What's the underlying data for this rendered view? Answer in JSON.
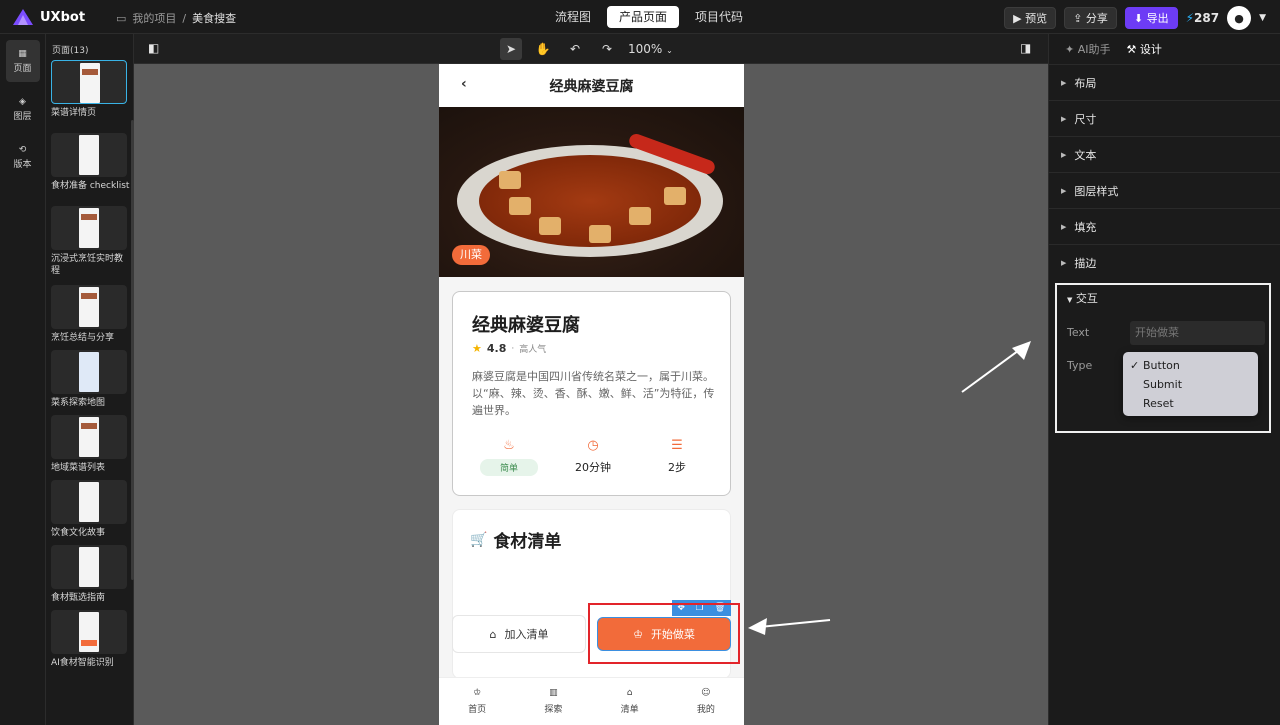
{
  "app": {
    "name": "UXbot",
    "credits": "287"
  },
  "breadcrumb": {
    "project_root": "我的项目",
    "separator": "/",
    "current": "美食搜查"
  },
  "top_tabs": [
    {
      "label": "流程图"
    },
    {
      "label": "产品页面"
    },
    {
      "label": "项目代码"
    }
  ],
  "top_actions": {
    "preview": "预览",
    "share": "分享",
    "export": "导出"
  },
  "rail": [
    {
      "label": "页面"
    },
    {
      "label": "图层"
    },
    {
      "label": "版本"
    }
  ],
  "pages_panel": {
    "header": "页面(13)",
    "items": [
      {
        "label": "菜谱详情页"
      },
      {
        "label": "食材准备 checklist"
      },
      {
        "label": "沉浸式烹饪实时教程"
      },
      {
        "label": "烹饪总结与分享"
      },
      {
        "label": "菜系探索地图"
      },
      {
        "label": "地域菜谱列表"
      },
      {
        "label": "饮食文化故事"
      },
      {
        "label": "食材甄选指南"
      },
      {
        "label": "AI食材智能识别"
      }
    ]
  },
  "canvas_tools": {
    "zoom": "100%"
  },
  "phone": {
    "header_title": "经典麻婆豆腐",
    "hero_tag": "川菜",
    "card": {
      "title": "经典麻婆豆腐",
      "rating": "4.8",
      "rating_sep": "·",
      "popularity": "高人气",
      "description": "麻婆豆腐是中国四川省传统名菜之一，属于川菜。以“麻、辣、烫、香、酥、嫩、鲜、活”为特征，传遍世界。",
      "stats": [
        {
          "label": "简单"
        },
        {
          "label": "20分钟"
        },
        {
          "label": "2步"
        }
      ]
    },
    "ingredients_title": "食材清单",
    "add_list_label": "加入清单",
    "start_label": "开始做菜",
    "nav": [
      {
        "label": "首页"
      },
      {
        "label": "探索"
      },
      {
        "label": "清单"
      },
      {
        "label": "我的"
      }
    ]
  },
  "right_panel": {
    "tabs": [
      {
        "label": "AI助手"
      },
      {
        "label": "设计"
      }
    ],
    "sections": [
      {
        "label": "布局"
      },
      {
        "label": "尺寸"
      },
      {
        "label": "文本"
      },
      {
        "label": "图层样式"
      },
      {
        "label": "填充"
      },
      {
        "label": "描边"
      },
      {
        "label": "交互"
      }
    ],
    "interaction": {
      "text_label": "Text",
      "text_value": "开始做菜",
      "type_label": "Type",
      "options": [
        {
          "label": "Button"
        },
        {
          "label": "Submit"
        },
        {
          "label": "Reset"
        }
      ],
      "selected": "Button"
    }
  },
  "colors": {
    "accent": "#f26b3a",
    "export": "#6d3cf5",
    "selection": "#3b8fe0",
    "highlight": "#e2242a"
  }
}
